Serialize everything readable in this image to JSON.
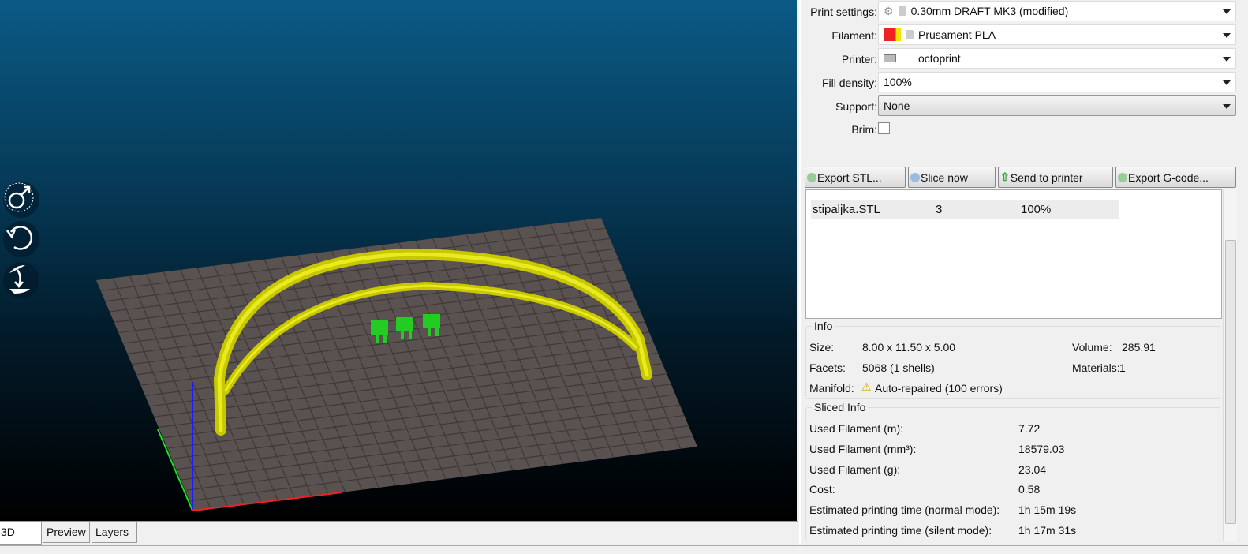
{
  "viewport": {
    "tabs": [
      "3D",
      "Preview",
      "Layers"
    ],
    "nav_icons": [
      "move-icon",
      "rotate-icon",
      "place-on-face-icon"
    ]
  },
  "settings": {
    "print": {
      "label": "Print settings:",
      "value": "0.30mm DRAFT MK3 (modified)"
    },
    "filament": {
      "label": "Filament:",
      "value": "Prusament PLA"
    },
    "printer": {
      "label": "Printer:",
      "value": "octoprint"
    },
    "fill": {
      "label": "Fill density:",
      "value": "100%"
    },
    "support": {
      "label": "Support:",
      "value": "None"
    },
    "brim": {
      "label": "Brim:",
      "checked": false
    }
  },
  "actions": {
    "export_stl": "Export STL...",
    "slice": "Slice now",
    "send": "Send to printer",
    "export_gcode": "Export G-code..."
  },
  "objects": [
    {
      "name": "stipaljka.STL",
      "copies": "3",
      "scale": "100%"
    }
  ],
  "info": {
    "title": "Info",
    "size_label": "Size:",
    "size": "8.00 x 11.50 x 5.00",
    "volume_label": "Volume:",
    "volume": "285.91",
    "facets_label": "Facets:",
    "facets": "5068 (1 shells)",
    "materials_label": "Materials:",
    "materials": "1",
    "manifold_label": "Manifold:",
    "manifold": "Auto-repaired (100 errors)"
  },
  "sliced": {
    "title": "Sliced Info",
    "rows": [
      {
        "label": "Used Filament (m):",
        "value": "7.72"
      },
      {
        "label": "Used Filament (mm³):",
        "value": "18579.03"
      },
      {
        "label": "Used Filament (g):",
        "value": "23.04"
      },
      {
        "label": "Cost:",
        "value": "0.58"
      },
      {
        "label": "Estimated printing time (normal mode):",
        "value": "1h 15m 19s"
      },
      {
        "label": "Estimated printing time (silent mode):",
        "value": "1h 17m 31s"
      }
    ]
  },
  "colors": {
    "filament_a": "#ee2222",
    "filament_b": "#f2e400",
    "model": "#d4d400",
    "clip": "#22cc22"
  }
}
